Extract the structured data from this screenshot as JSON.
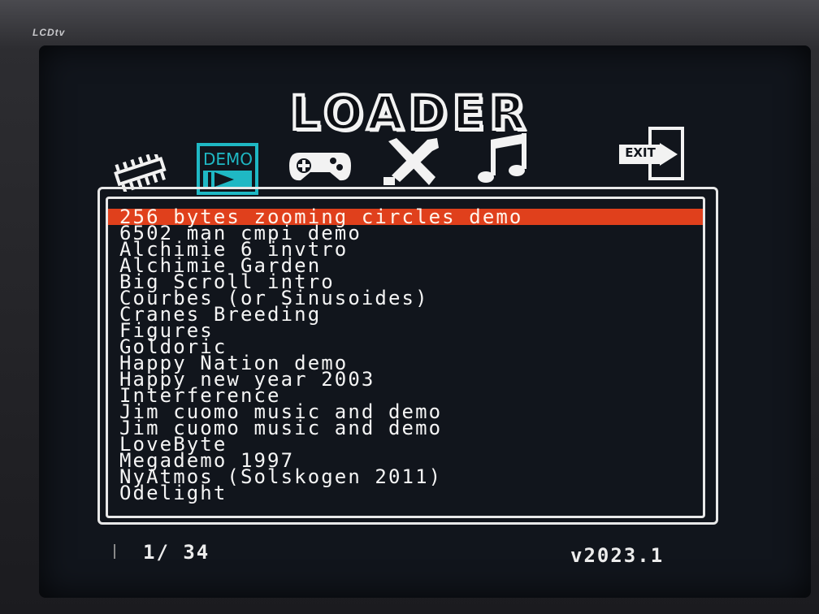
{
  "monitor": {
    "brand": "LCDtv"
  },
  "header": {
    "title": "LOADER"
  },
  "tabs": [
    {
      "icon": "chip-icon",
      "label": ""
    },
    {
      "icon": "demo-icon",
      "label": "DEMO",
      "active": true
    },
    {
      "icon": "gamepad-icon",
      "label": ""
    },
    {
      "icon": "tools-icon",
      "label": ""
    },
    {
      "icon": "music-icon",
      "label": ""
    }
  ],
  "exit": {
    "icon": "exit-icon",
    "label": "EXIT"
  },
  "list": {
    "selected_index": 0,
    "items": [
      "256 bytes zooming circles demo",
      "6502 man cmpi demo",
      "Alchimie 6 invtro",
      "Alchimie Garden",
      "Big Scroll intro",
      "Courbes (or Sinusoides)",
      "Cranes Breeding",
      "Figures",
      "Goldoric",
      "Happy Nation demo",
      "Happy new year 2003",
      "Interference",
      "Jim cuomo music and demo",
      "Jim cuomo music and demo",
      "LoveByte",
      "Megademo 1997",
      "NyAtmos (Solskogen 2011)",
      "Odelight"
    ]
  },
  "footer": {
    "counter": "1/ 34",
    "version": "v2023.1"
  },
  "colors": {
    "accent": "#e0401c",
    "tab_active": "#1fb8c4",
    "text": "#f5f5f5",
    "background": "#11151c"
  }
}
